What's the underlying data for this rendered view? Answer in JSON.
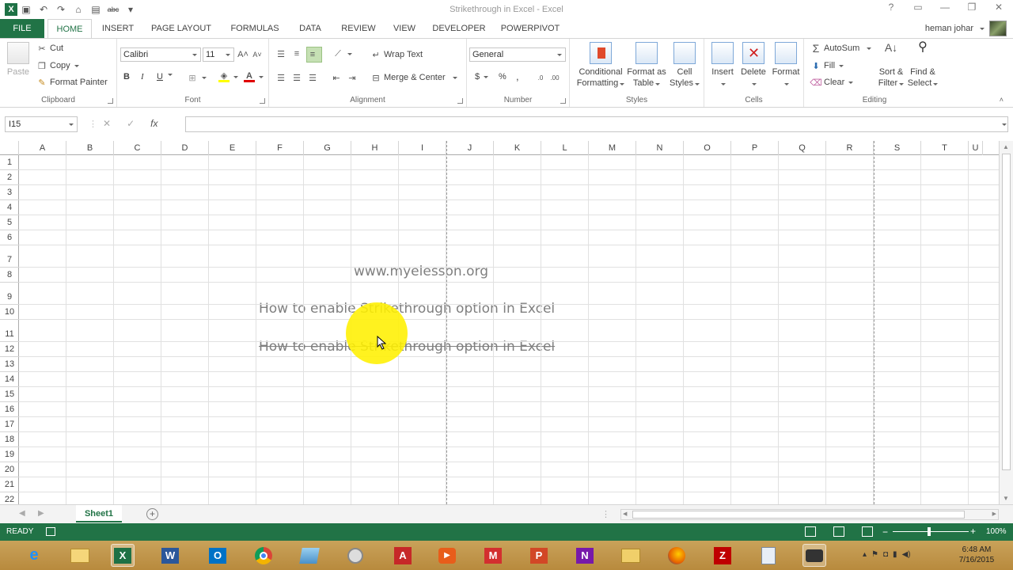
{
  "window": {
    "title": "Strikethrough in Excel - Excel"
  },
  "tabs": [
    "FILE",
    "HOME",
    "INSERT",
    "PAGE LAYOUT",
    "FORMULAS",
    "DATA",
    "REVIEW",
    "VIEW",
    "DEVELOPER",
    "POWERPIVOT"
  ],
  "user": {
    "name": "heman johar"
  },
  "ribbon": {
    "clipboard": {
      "paste": "Paste",
      "cut": "Cut",
      "copy": "Copy",
      "format_painter": "Format Painter",
      "label": "Clipboard"
    },
    "font": {
      "name": "Calibri",
      "size": "11",
      "bold": "B",
      "italic": "I",
      "underline": "U",
      "label": "Font"
    },
    "alignment": {
      "wrap_text": "Wrap Text",
      "merge_center": "Merge & Center",
      "label": "Alignment"
    },
    "number": {
      "format": "General",
      "currency": "$",
      "percent": "%",
      "comma": ",",
      "label": "Number"
    },
    "styles": {
      "conditional_line1": "Conditional",
      "conditional_line2": "Formatting",
      "table_line1": "Format as",
      "table_line2": "Table",
      "cell_line1": "Cell",
      "cell_line2": "Styles",
      "label": "Styles"
    },
    "cells": {
      "insert": "Insert",
      "delete": "Delete",
      "format": "Format",
      "label": "Cells"
    },
    "editing": {
      "autosum": "AutoSum",
      "fill": "Fill",
      "clear": "Clear",
      "sort_line1": "Sort &",
      "sort_line2": "Filter",
      "find_line1": "Find &",
      "find_line2": "Select",
      "label": "Editing"
    }
  },
  "formula_bar": {
    "name_box": "I15",
    "cancel": "✕",
    "enter": "✓",
    "fx": "fx",
    "value": ""
  },
  "columns": [
    "A",
    "B",
    "C",
    "D",
    "E",
    "F",
    "G",
    "H",
    "I",
    "J",
    "K",
    "L",
    "M",
    "N",
    "O",
    "P",
    "Q",
    "R",
    "S",
    "T",
    "U"
  ],
  "rows": [
    "1",
    "2",
    "3",
    "4",
    "5",
    "6",
    "7",
    "8",
    "9",
    "10",
    "11",
    "12",
    "13",
    "14",
    "15",
    "16",
    "17",
    "18",
    "19",
    "20",
    "21",
    "22"
  ],
  "cells": {
    "website": "www.myelesson.org",
    "heading": "How to enable Strikethrough option in Excel",
    "strike": "How to enable Strikethrough option in Excel"
  },
  "sheets": {
    "active": "Sheet1",
    "add": "+"
  },
  "status": {
    "ready": "READY",
    "zoom": "100%",
    "minus": "−",
    "plus": "+"
  },
  "taskbar": {
    "apps": [
      "ie-icon",
      "explorer-icon",
      "excel-icon",
      "word-icon",
      "outlook-icon",
      "chrome-icon",
      "notes-icon",
      "paint-icon",
      "acrobat-icon",
      "media-icon",
      "m-icon",
      "powerpoint-icon",
      "onenote-icon",
      "folder-icon",
      "firefox-icon",
      "filezilla-icon",
      "doc-icon",
      "camera-icon"
    ],
    "labels": {
      "excel": "X",
      "word": "W",
      "outlook": "O",
      "acrobat": "A",
      "m": "M",
      "powerpoint": "P",
      "onenote": "N",
      "filezilla": "Z"
    },
    "time": "6:48 AM",
    "date": "7/16/2015"
  },
  "colors": {
    "excel_green": "#217346",
    "strike_text": "#7f7f7f",
    "highlight": "#fff000",
    "taskbar": "#c29748"
  }
}
